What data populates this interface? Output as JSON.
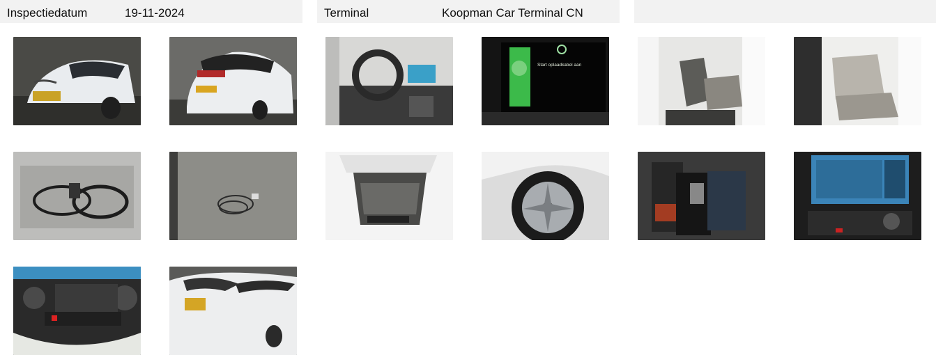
{
  "header": {
    "inspection_label": "Inspectiedatum",
    "inspection_date": "19-11-2024",
    "terminal_label": "Terminal",
    "terminal_value": "Koopman Car Terminal CN"
  },
  "photos": [
    {
      "name": "photo-front-left-exterior"
    },
    {
      "name": "photo-rear-left-exterior"
    },
    {
      "name": "photo-dashboard-interior"
    },
    {
      "name": "photo-instrument-cluster",
      "text": "Start oplaadkabel aan"
    },
    {
      "name": "photo-front-seats"
    },
    {
      "name": "photo-rear-seats"
    },
    {
      "name": "photo-trunk-charging-cables"
    },
    {
      "name": "photo-charging-cable-floor"
    },
    {
      "name": "photo-trunk-open"
    },
    {
      "name": "photo-wheel-rim"
    },
    {
      "name": "photo-manuals-keys"
    },
    {
      "name": "photo-infotainment-screen"
    },
    {
      "name": "photo-climate-controls"
    },
    {
      "name": "photo-front-bumper-headlight"
    }
  ]
}
